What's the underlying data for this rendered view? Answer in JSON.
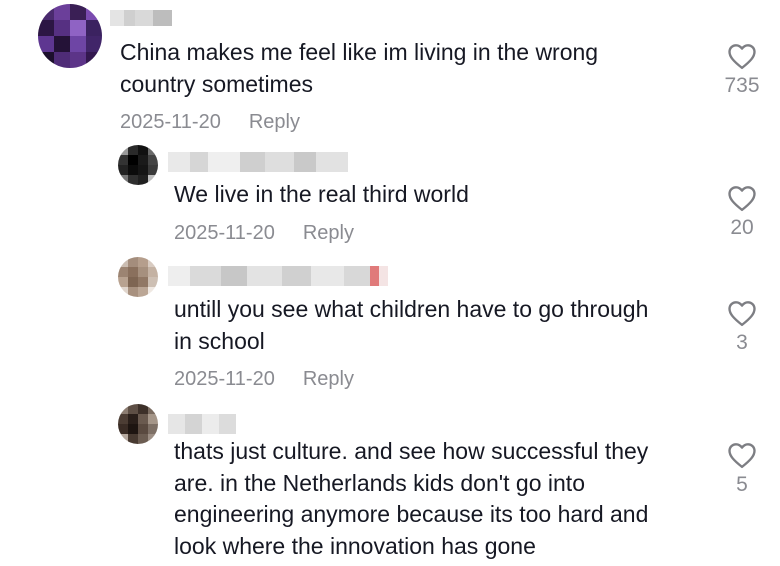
{
  "comments": [
    {
      "text": "China makes me feel like im living in the wrong\ncountry sometimes",
      "date": "2025-11-20",
      "reply_label": "Reply",
      "likes": "735",
      "avatar_colors": [
        "#4a2a6e",
        "#6b3f9a",
        "#3a1f55",
        "#7b4bb0",
        "#2c1644",
        "#563082",
        "#8f63c4",
        "#3b2260",
        "#5e3691",
        "#241237",
        "#6e45a5",
        "#412569",
        "#1c0f2c",
        "#4f2c77",
        "#5c3488",
        "#33184f"
      ]
    },
    {
      "text": "We live in the real third world",
      "date": "2025-11-20",
      "reply_label": "Reply",
      "likes": "20",
      "avatar_colors": [
        "#9a9a9a",
        "#2a2a2a",
        "#111111",
        "#6a6a6a",
        "#333333",
        "#000000",
        "#1a1a1a",
        "#444444",
        "#222222",
        "#0b0b0b",
        "#151515",
        "#3a3a3a",
        "#777777",
        "#2f2f2f",
        "#202020",
        "#bdbdbd"
      ]
    },
    {
      "text": "untill you see what children have to go through\nin school",
      "date": "2025-11-20",
      "reply_label": "Reply",
      "likes": "3",
      "avatar_colors": [
        "#cbbdb2",
        "#a48d7c",
        "#b59e8c",
        "#d8cbc1",
        "#9c8472",
        "#8a705d",
        "#a6907e",
        "#c4b2a3",
        "#b8a290",
        "#7e6552",
        "#917865",
        "#cdbfb3",
        "#e0d5cc",
        "#a8917f",
        "#bba695",
        "#efe8e2"
      ]
    },
    {
      "text": "thats just culture. and see how successful they\nare. in the Netherlands kids don't go into\nengineering anymore because its too hard and\nlook where the innovation has gone",
      "likes": "5",
      "avatar_colors": [
        "#8c7d72",
        "#5e4f45",
        "#3d3029",
        "#7a6b60",
        "#4c3d34",
        "#2a1f1a",
        "#6a5a4f",
        "#a59689",
        "#3a2c25",
        "#1e1511",
        "#5a4a40",
        "#7e7066",
        "#b6a99f",
        "#483a31",
        "#6c5d52",
        "#9d8f85"
      ]
    }
  ]
}
